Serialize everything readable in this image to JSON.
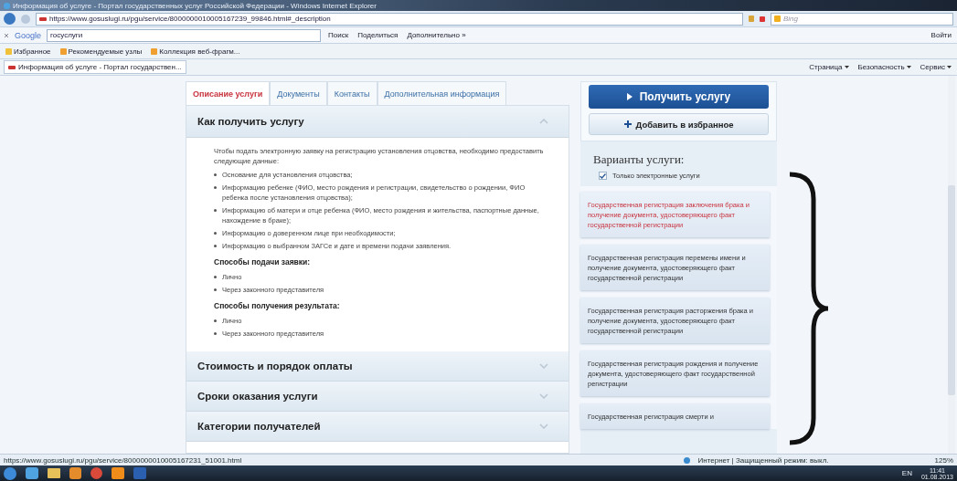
{
  "window": {
    "title": "Информация об услуге - Портал государственных услуг Российской Федерации - Windows Internet Explorer"
  },
  "address_bar": {
    "url": "https://www.gosuslugi.ru/pgu/service/8000000010005167239_99846.html#_description",
    "search_placeholder": "Bing"
  },
  "google_bar": {
    "logo": "Google",
    "query": "госуслуги",
    "buttons": [
      "Поиск",
      "Поделиться",
      "Дополнительно »"
    ],
    "signin": "Войти"
  },
  "favorites_bar": {
    "items": [
      "Избранное",
      "Рекомендуемые узлы",
      "Коллекция веб-фрагм..."
    ]
  },
  "browser_tabs": [
    {
      "label": "Информация об услуге - Портал государствен...",
      "selected": true
    }
  ],
  "command_bar": [
    "Страница",
    "Безопасность",
    "Сервис"
  ],
  "page_tabs": [
    {
      "label": "Описание услуги",
      "selected": true
    },
    {
      "label": "Документы",
      "selected": false
    },
    {
      "label": "Контакты",
      "selected": false
    },
    {
      "label": "Дополнительная информация",
      "selected": false
    }
  ],
  "accordion": [
    {
      "title": "Как получить услугу",
      "expanded": true,
      "intro": "Чтобы подать электронную заявку на регистрацию установления отцовства, необходимо предоставить следующие данные:",
      "bullets": [
        "Основание для установления отцовства;",
        "Информацию ребенке (ФИО, место рождения и регистрации, свидетельство о рождении, ФИО ребенка после установления отцовства);",
        "Информацию об матери и отце ребенка (ФИО, место рождения и жительства, паспортные данные, нахождение в браке);",
        "Информацию о доверенном лице при необходимости;",
        "Информацию о выбранном ЗАГСе и дате и времени подачи заявления."
      ],
      "groups": [
        {
          "heading": "Способы подачи заявки:",
          "items": [
            "Лично",
            "Через законного представителя"
          ]
        },
        {
          "heading": "Способы получения результата:",
          "items": [
            "Лично",
            "Через законного представителя"
          ]
        }
      ]
    },
    {
      "title": "Стоимость и порядок оплаты",
      "expanded": false
    },
    {
      "title": "Сроки оказания услуги",
      "expanded": false
    },
    {
      "title": "Категории получателей",
      "expanded": false
    }
  ],
  "actions": {
    "primary": "Получить услугу",
    "secondary": "Добавить в избранное"
  },
  "variants": {
    "title": "Варианты услуги:",
    "filter": {
      "label": "Только электронные услуги",
      "checked": true
    },
    "items": [
      {
        "text": "Государственная регистрация заключения брака и получение документа, удостоверяющего факт государственной регистрации",
        "selected": true
      },
      {
        "text": "Государственная регистрация перемены имени и получение документа, удостоверяющего факт государственной регистрации",
        "selected": false
      },
      {
        "text": "Государственная регистрация расторжения брака и получение документа, удостоверяющего факт государственной регистрации",
        "selected": false
      },
      {
        "text": "Государственная регистрация рождения и получение документа, удостоверяющего факт государственной регистрации",
        "selected": false
      },
      {
        "text": "Государственная регистрация смерти и",
        "selected": false
      }
    ]
  },
  "status_bar": {
    "url": "https://www.gosuslugi.ru/pgu/service/8000000010005167231_51001.html",
    "zone": "Интернет | Защищенный режим: выкл.",
    "zoom": "125%"
  },
  "taskbar": {
    "language": "EN",
    "time": "11:41",
    "date": "01.08.2013"
  }
}
